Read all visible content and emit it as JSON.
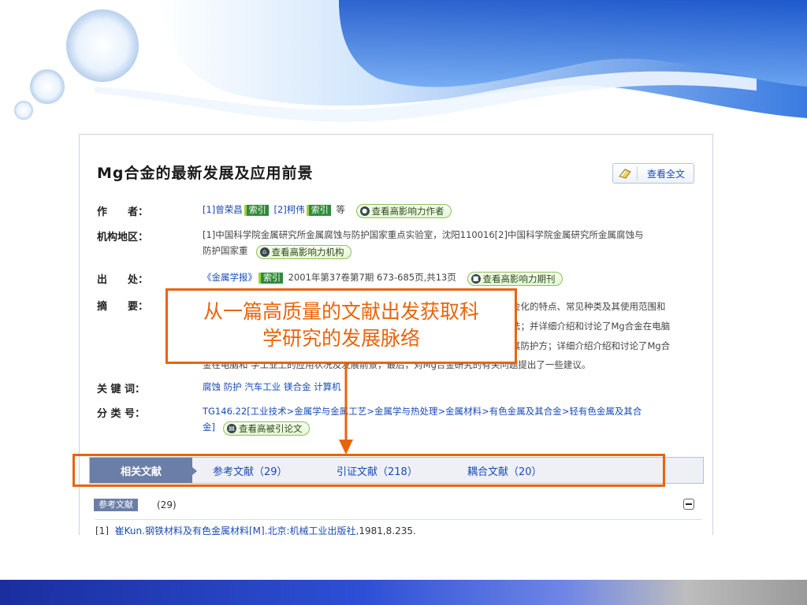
{
  "article": {
    "title_prefix": "Mg",
    "title_rest": "合金的最新发展及应用前景",
    "fulltext_label": "查看全文"
  },
  "fields": {
    "author": {
      "label": "作　　者：",
      "a1": "[1]曾荣昌",
      "a2": "[2]柯伟",
      "index_tag": "索引",
      "etc": "等",
      "action": "查看高影响力作者"
    },
    "org": {
      "label": "机构地区：",
      "line1": "[1]中国科学院金属研究所金属腐蚀与防护国家重点实验室，沈阳110016[2]中国科学院金属研究所金属腐蚀与",
      "line2": "防护国家重",
      "action": "查看高影响力机构"
    },
    "source": {
      "label": "出　　处：",
      "journal": "《金属学报》",
      "index_tag": "索引",
      "detail": "2001年第37卷第7期 673-685页,共13页",
      "action": "查看高影响力期刊"
    },
    "abstract": {
      "label": "摘　　要：",
      "line1": "金化的特点、常见种类及其使用范围和",
      "line2": "法；并详细介绍和讨论了Mg合金在电脑",
      "line3": "其防护方；详细介绍介绍和讨论了Mg合",
      "line4": "金在电脑和   学工业上的应用状况及发展前景，最后，对Mg合金研究的有关问题提出了一些建议。"
    },
    "keywords": {
      "label": "关 键 词：",
      "items": [
        "腐蚀",
        "防护",
        "汽车工业",
        "镁合金",
        "计算机"
      ]
    },
    "classification": {
      "label": "分 类 号：",
      "code": "TG146.22",
      "path_line1": "[工业技术>金属学与金属工艺>金属学与热处理>金属材料>有色金属及其合金>轻有色金属及其合",
      "path_line2": "金]",
      "action": "查看高被引论文"
    }
  },
  "tabs": {
    "related": "相关文献",
    "references": "参考文献（29）",
    "citations": "引证文献（218）",
    "coupled": "耦合文献（20）"
  },
  "refs": {
    "badge": "参考文献",
    "count": "(29)",
    "item1_num": "[1]",
    "item1_text": "崔Kun.钢铁材料及有色金属材料[M].北京:机械工业出版社,",
    "item1_tail": "1981,8.235."
  },
  "annotation": {
    "callout_line1": "从一篇高质量的文献出发获取科",
    "callout_line2": "学研究的发展脉络"
  },
  "colors": {
    "accent_orange": "#e8640c",
    "link_blue": "#1a4bb5",
    "tab_active_bg": "#6b7ea8",
    "index_tag_green": "#2f8a3a"
  }
}
